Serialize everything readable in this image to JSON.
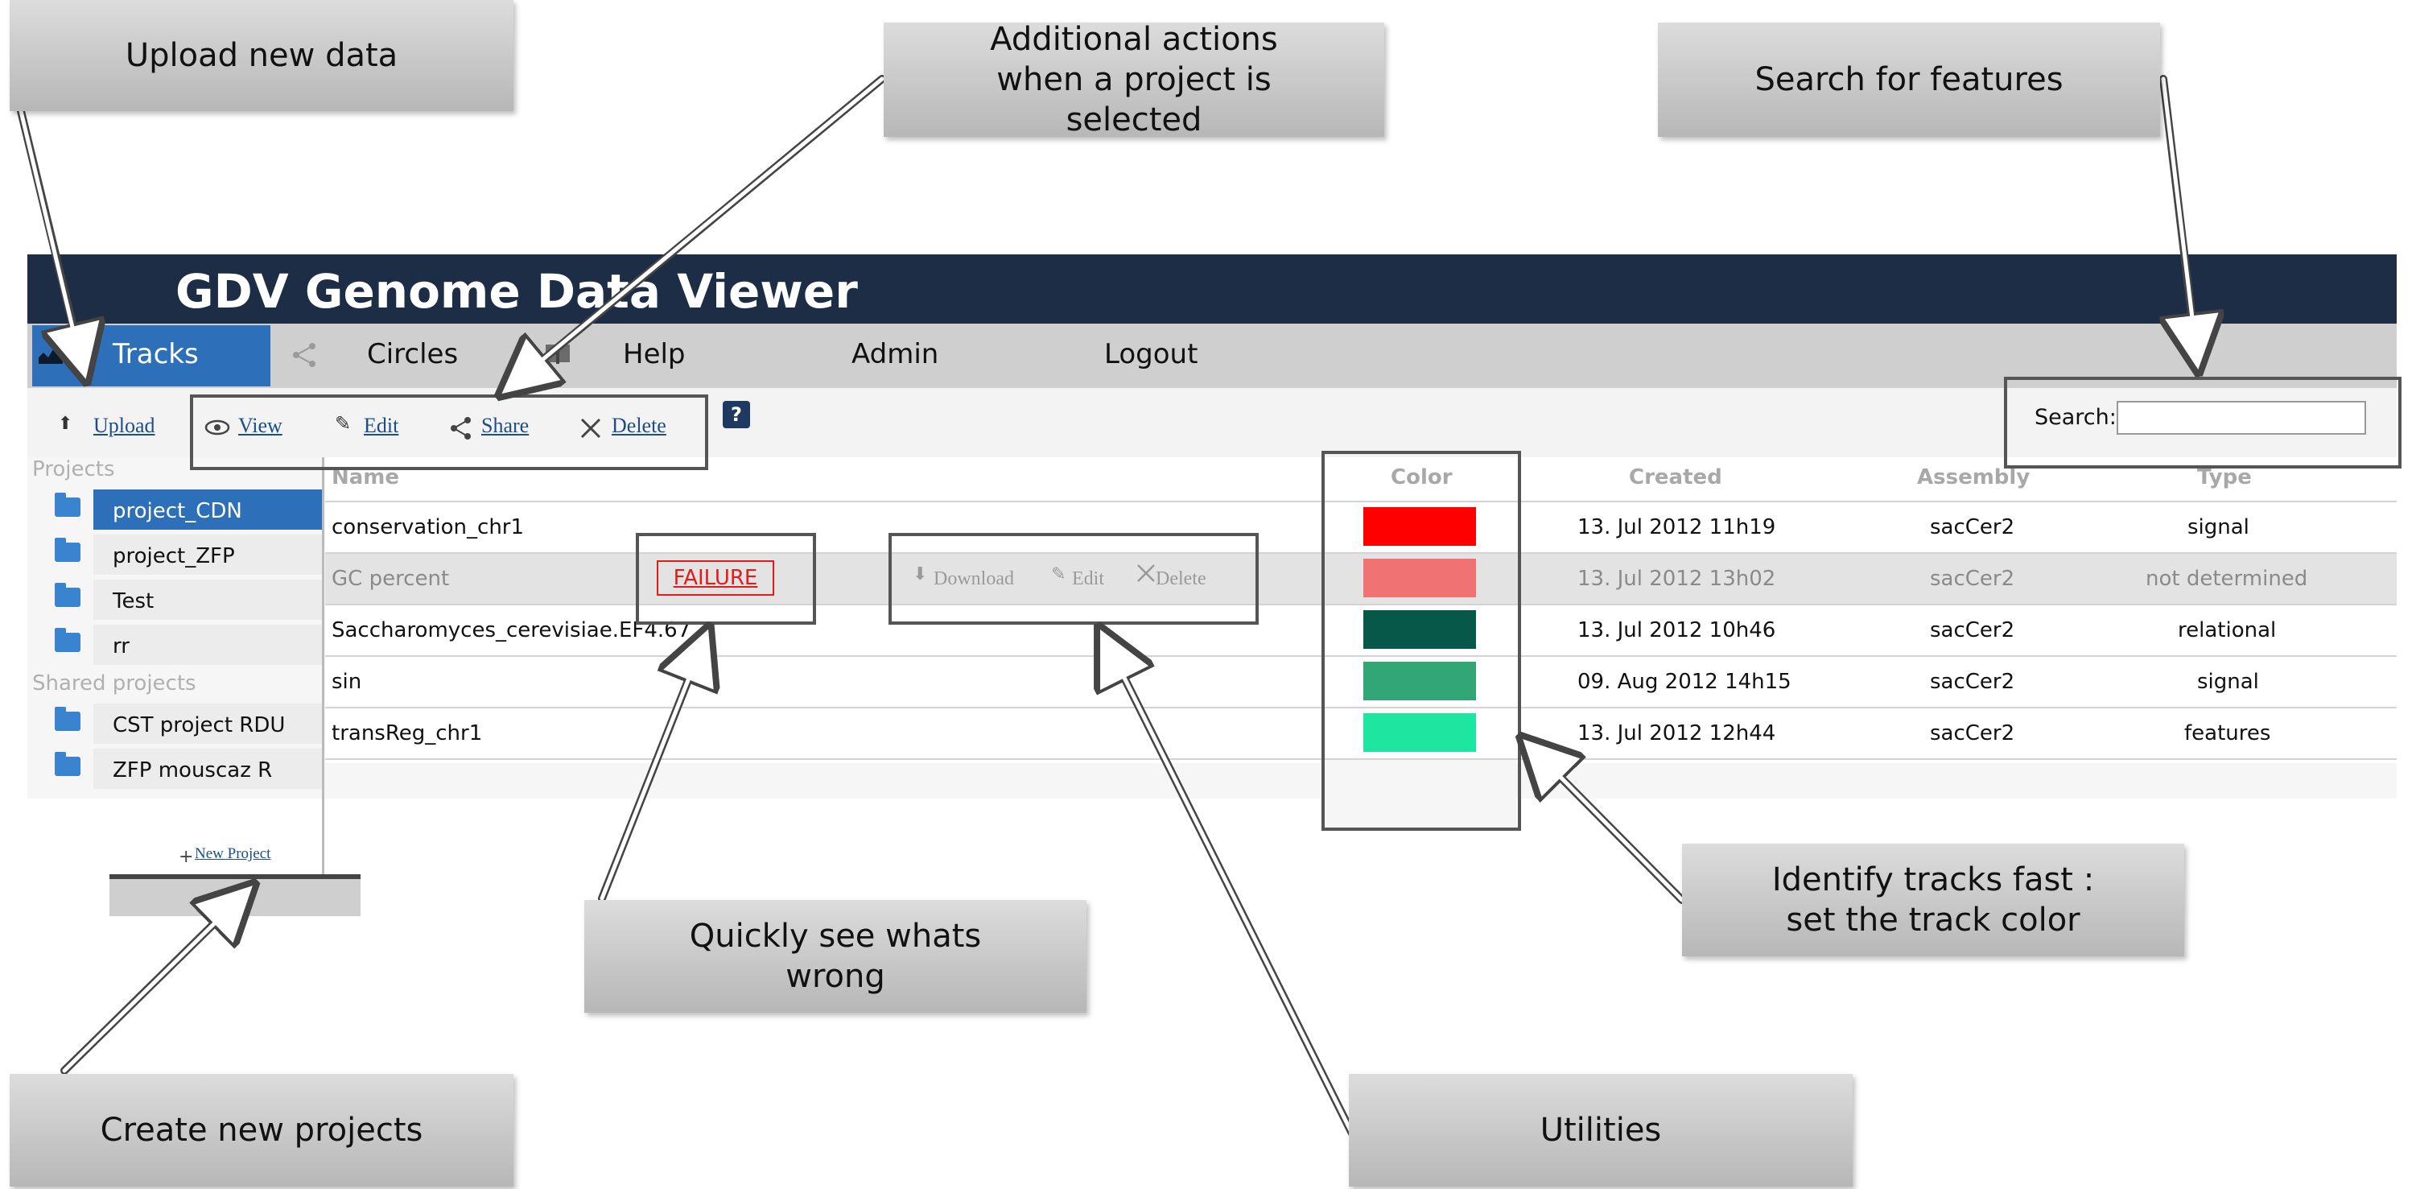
{
  "app": {
    "title": "GDV Genome Data Viewer"
  },
  "nav": {
    "tabs": [
      {
        "label": "Tracks",
        "active": true
      },
      {
        "label": "Circles"
      },
      {
        "label": "Help"
      },
      {
        "label": "Admin"
      },
      {
        "label": "Logout"
      }
    ]
  },
  "toolbar": {
    "upload": "Upload",
    "view": "View",
    "edit": "Edit",
    "share": "Share",
    "delete": "Delete",
    "help_badge": "?",
    "search_label": "Search:",
    "search_value": ""
  },
  "sidebar": {
    "projects_header": "Projects",
    "projects": [
      "project_CDN",
      "project_ZFP",
      "Test",
      "rr"
    ],
    "selected_project": "project_CDN",
    "shared_header": "Shared projects",
    "shared_projects": [
      "CST project RDU",
      "ZFP mouscaz R"
    ],
    "new_project": "New Project"
  },
  "table": {
    "columns": [
      "Name",
      "Color",
      "Created",
      "Assembly",
      "Type"
    ],
    "rows": [
      {
        "name": "conservation_chr1",
        "color": "#ff0000",
        "created": "13. Jul 2012 11h19",
        "assembly": "sacCer2",
        "type": "signal"
      },
      {
        "name": "GC percent",
        "status": "FAILURE",
        "color": "#f07272",
        "created": "13. Jul 2012 13h02",
        "assembly": "sacCer2",
        "type": "not determined"
      },
      {
        "name": "Saccharomyces_cerevisiae.EF4.67",
        "color": "#075849",
        "created": "13. Jul 2012 10h46",
        "assembly": "sacCer2",
        "type": "relational"
      },
      {
        "name": "sin",
        "color": "#32a775",
        "created": "09. Aug 2012 14h15",
        "assembly": "sacCer2",
        "type": "signal"
      },
      {
        "name": "transReg_chr1",
        "color": "#1de6a1",
        "created": "13. Jul 2012 12h44",
        "assembly": "sacCer2",
        "type": "features"
      }
    ],
    "row_utilities": {
      "download": "Download",
      "edit": "Edit",
      "delete": "Delete"
    }
  },
  "callouts": {
    "upload": "Upload new data",
    "actions": [
      "Additional actions",
      "when a project is",
      "selected"
    ],
    "search": "Search for features",
    "color": [
      "Identify tracks fast :",
      "set the track color"
    ],
    "failure": [
      "Quickly see whats",
      "wrong"
    ],
    "new_projects": "Create new projects",
    "utilities": "Utilities"
  },
  "icons": {
    "upload": "upload-arrow-icon",
    "view": "eye-icon",
    "edit": "pencil-icon",
    "share": "share-icon",
    "delete": "x-icon",
    "folder": "folder-icon",
    "tracks": "chart-icon",
    "circles": "share-icon",
    "help": "book-icon"
  },
  "colors": {
    "header": "#1e2d46",
    "active_tab": "#2e6fb9",
    "failure": "#e21b1b"
  }
}
